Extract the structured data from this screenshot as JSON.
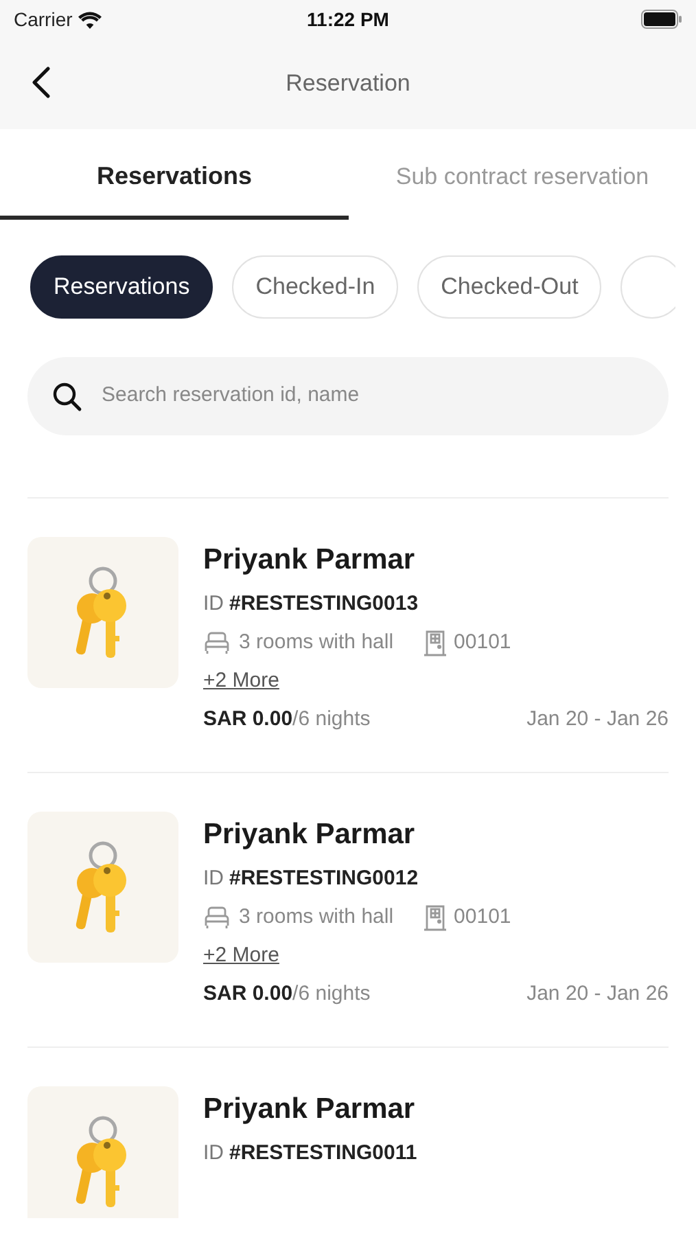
{
  "status_bar": {
    "carrier": "Carrier",
    "time": "11:22 PM"
  },
  "nav": {
    "title": "Reservation"
  },
  "tabs": [
    {
      "label": "Reservations",
      "selected": true
    },
    {
      "label": "Sub contract reservation",
      "selected": false
    }
  ],
  "filters": [
    {
      "label": "Reservations",
      "selected": true
    },
    {
      "label": "Checked-In",
      "selected": false
    },
    {
      "label": "Checked-Out",
      "selected": false
    },
    {
      "selected": false
    }
  ],
  "search": {
    "placeholder": "Search reservation id, name"
  },
  "reservations": [
    {
      "name": "Priyank Parmar",
      "id_label": "ID",
      "id": "#RESTESTING0013",
      "room_type": "3 rooms with hall",
      "room_no": "00101",
      "more": "+2 More",
      "price": "SAR 0.00",
      "nights": "/6 nights",
      "dates": "Jan 20 - Jan 26"
    },
    {
      "name": "Priyank Parmar",
      "id_label": "ID",
      "id": "#RESTESTING0012",
      "room_type": "3 rooms with hall",
      "room_no": "00101",
      "more": "+2 More",
      "price": "SAR 0.00",
      "nights": "/6 nights",
      "dates": "Jan 20 - Jan 26"
    },
    {
      "name": "Priyank Parmar",
      "id_label": "ID",
      "id": "#RESTESTING0011"
    }
  ]
}
